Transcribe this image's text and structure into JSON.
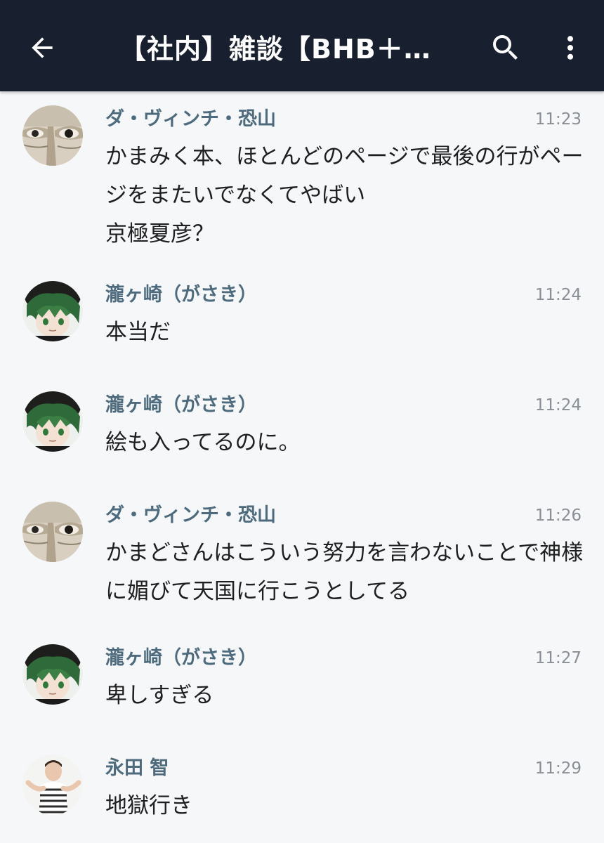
{
  "header": {
    "back_icon": "back-arrow-icon",
    "title": "【社内】雑談【BHB＋バ…",
    "search_icon": "search-icon",
    "more_icon": "more-vertical-icon",
    "background": "#18202f"
  },
  "messages": [
    {
      "sender": "ダ・ヴィンチ・恐山",
      "time": "11:23",
      "text": "かまみく本、ほとんどのページで最後の行がペー\nジをまたいでなくてやばい\n京極夏彦？",
      "avatar": "eyes-photo"
    },
    {
      "sender": "瀧ヶ崎（がさき）",
      "time": "11:24",
      "text": "本当だ",
      "avatar": "green-hair-character"
    },
    {
      "sender": "瀧ヶ崎（がさき）",
      "time": "11:24",
      "text": "絵も入ってるのに。",
      "avatar": "green-hair-character"
    },
    {
      "sender": "ダ・ヴィンチ・恐山",
      "time": "11:26",
      "text": "かまどさんはこういう努力を言わないことで神様\nに媚びて天国に行こうとしてる",
      "avatar": "eyes-photo"
    },
    {
      "sender": "瀧ヶ崎（がさき）",
      "time": "11:27",
      "text": "卑しすぎる",
      "avatar": "green-hair-character"
    },
    {
      "sender": "永田 智",
      "time": "11:29",
      "text": "地獄行き",
      "avatar": "person-photo"
    }
  ]
}
